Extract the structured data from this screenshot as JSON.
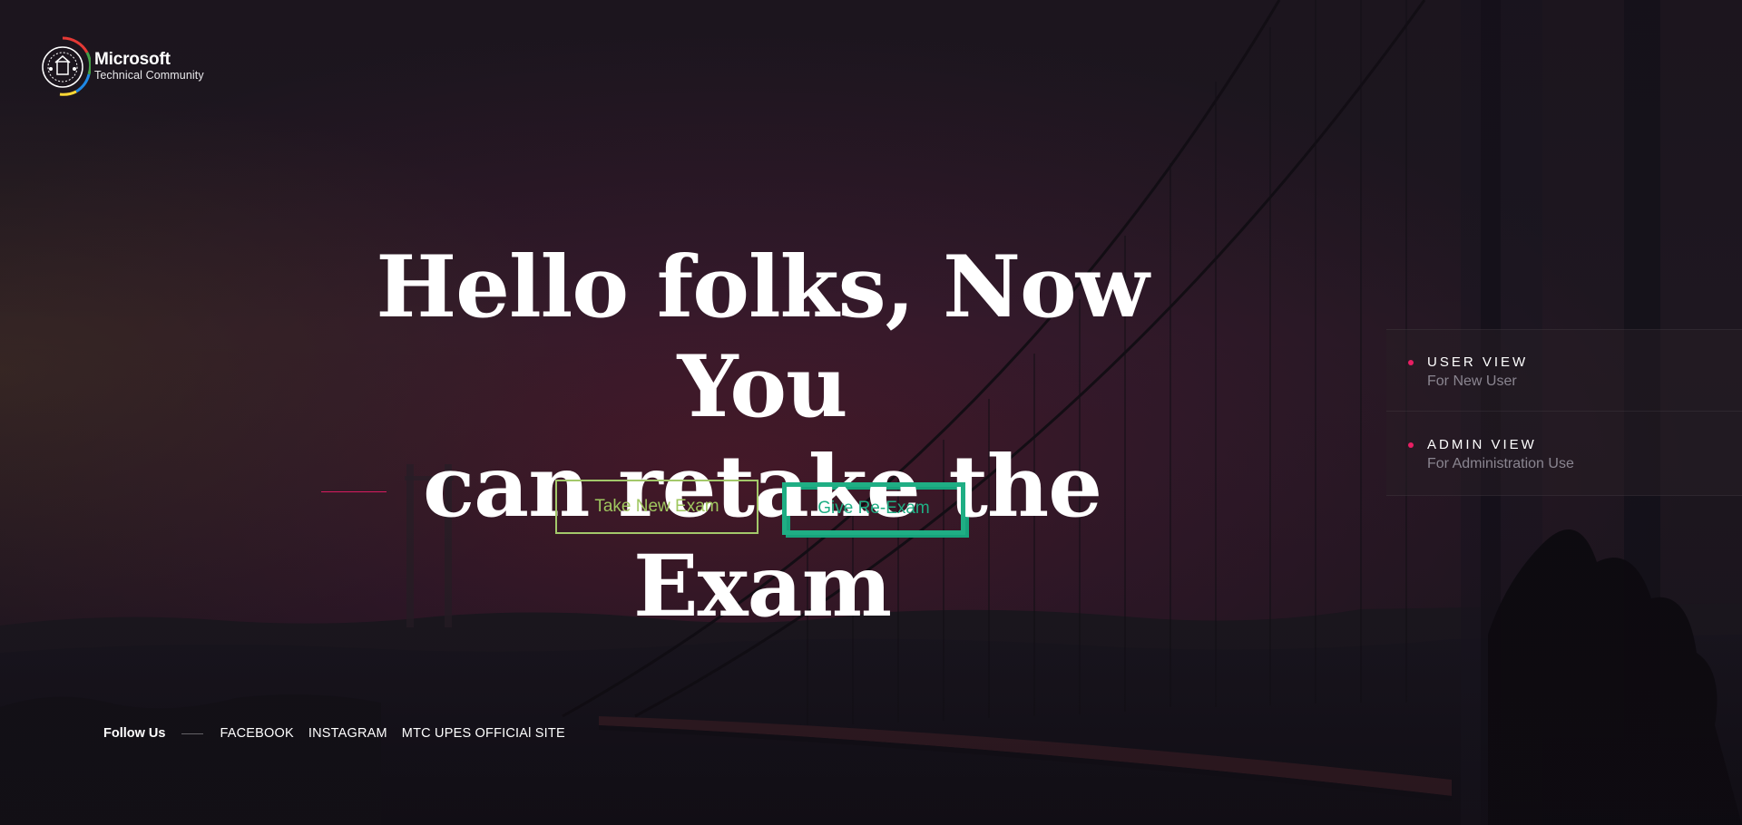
{
  "logo": {
    "title": "Microsoft",
    "subtitle": "Technical Community",
    "icon": "mtc-logo-icon"
  },
  "hero": {
    "line1": "Hello folks, Now You",
    "line2": "can retake the Exam"
  },
  "buttons": {
    "take_new": "Take New Exam",
    "give_re": "Give Re-Exam"
  },
  "side_panel": {
    "items": [
      {
        "title": "USER VIEW",
        "subtitle": "For New User"
      },
      {
        "title": "ADMIN VIEW",
        "subtitle": "For Administration Use"
      }
    ]
  },
  "footer": {
    "follow_label": "Follow Us",
    "links": [
      "FACEBOOK",
      "INSTAGRAM",
      "MTC UPES OFFICIAl SITE"
    ]
  },
  "colors": {
    "accent_pink": "#e91e63",
    "button_green_light": "#a3c86a",
    "button_teal": "#1fae84",
    "background": "#1c1620"
  }
}
